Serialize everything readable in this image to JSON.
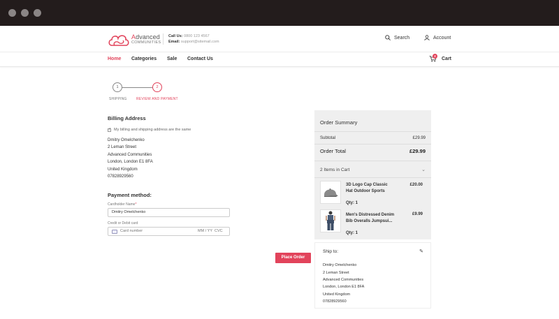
{
  "brand": {
    "name_accent": "A",
    "name_rest": "dvanced",
    "subname": "COMMUNITIES",
    "call_label": "Call Us:",
    "call_value": "0800 123 4567",
    "email_label": "Email:",
    "email_value": "support@sitemail.com",
    "accent_color": "#e2435b"
  },
  "header_actions": {
    "search_label": "Search",
    "account_label": "Account"
  },
  "nav": {
    "items": [
      {
        "label": "Home",
        "active": true
      },
      {
        "label": "Categories",
        "active": false
      },
      {
        "label": "Sale",
        "active": false
      },
      {
        "label": "Contact Us",
        "active": false
      }
    ],
    "cart_label": "Cart",
    "cart_count": "2"
  },
  "steps": [
    {
      "number": "1",
      "label": "SHIPPING"
    },
    {
      "number": "2",
      "label": "REVIEW AND PAYMENT"
    }
  ],
  "billing": {
    "title": "Billing Address",
    "same_address_label": "My billing and shipping address are the same",
    "lines": [
      "Dmitry Omelchenko",
      "2 Leman Street",
      "Advanced Communities",
      "London, London E1 8FA",
      "United Kingdom",
      "07828929560"
    ]
  },
  "payment": {
    "title": "Payment method:",
    "cardholder_label": "Cardholder Name",
    "cardholder_required": "*",
    "cardholder_value": "Dmitry Omelchenko",
    "card_label": "Credit or Debit card",
    "card_number_placeholder": "Card number",
    "expiry_placeholder": "MM / YY",
    "cvc_placeholder": "CVC",
    "place_order_label": "Place Order"
  },
  "summary": {
    "title": "Order Summary",
    "subtotal_label": "Subtotal",
    "subtotal_value": "£29.99",
    "total_label": "Order Total",
    "total_value": "£29.99",
    "items_count_label": "2 Items in Cart",
    "items": [
      {
        "name": "3D Logo Cap Classic Hat Outdoor Sports",
        "qty": "Qty: 1",
        "price": "£20.00",
        "icon": "cap-icon"
      },
      {
        "name": "Men's Distressed Denim Bib Overalls Jumpsui...",
        "qty": "Qty: 1",
        "price": "£9.99",
        "icon": "overalls-icon"
      }
    ]
  },
  "ship_to": {
    "title": "Ship to:",
    "lines": [
      "Dmitry Omelchenko",
      "2 Leman Street",
      "Advanced Communities",
      "London, London E1 8FA",
      "United Kingdom",
      "07828929560"
    ]
  }
}
